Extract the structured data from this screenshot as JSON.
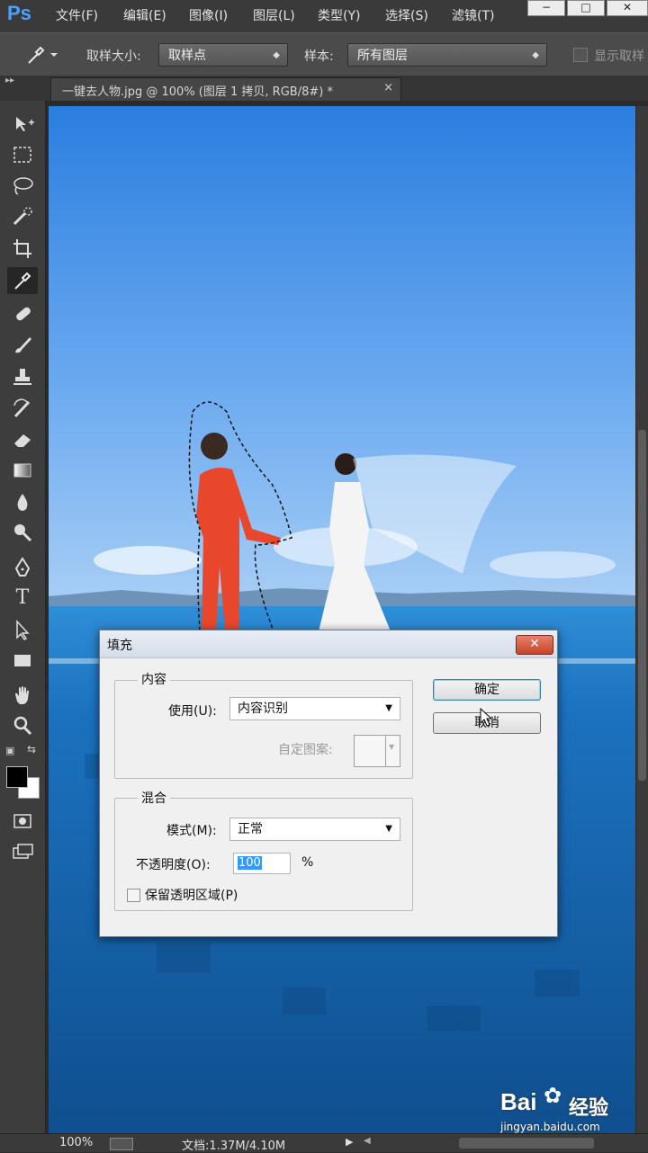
{
  "app": {
    "logo": "Ps",
    "menu": [
      "文件(F)",
      "编辑(E)",
      "图像(I)",
      "图层(L)",
      "类型(Y)",
      "选择(S)",
      "滤镜(T)"
    ],
    "window_buttons": [
      "−",
      "□",
      "✕"
    ]
  },
  "options_bar": {
    "tool_icon": "eyedropper-icon",
    "sample_size_label": "取样大小:",
    "sample_size_value": "取样点",
    "sample_label": "样本:",
    "sample_value": "所有图层",
    "show_ring_label": "显示取样"
  },
  "document_tab": {
    "title": "一键去人物.jpg @ 100% (图层 1 拷贝, RGB/8#) *",
    "close": "×"
  },
  "toolbar": {
    "tools": [
      "move-icon",
      "marquee-icon",
      "lasso-icon",
      "quick-select-icon",
      "crop-icon",
      "eyedropper-icon",
      "healing-brush-icon",
      "brush-icon",
      "clone-stamp-icon",
      "history-brush-icon",
      "eraser-icon",
      "gradient-icon",
      "blur-icon",
      "dodge-icon",
      "pen-icon",
      "type-icon",
      "path-select-icon",
      "rectangle-icon",
      "hand-icon",
      "zoom-icon"
    ],
    "type_glyph": "T",
    "active_tool": "eyedropper-icon",
    "foreground_color": "#000000",
    "background_color": "#ffffff"
  },
  "status_bar": {
    "zoom": "100%",
    "doc_info": "文档:1.37M/4.10M"
  },
  "dialog": {
    "title": "填充",
    "content_group": "内容",
    "use_label": "使用(U):",
    "use_value": "内容识别",
    "custom_pattern_label": "自定图案:",
    "blend_group": "混合",
    "mode_label": "模式(M):",
    "mode_value": "正常",
    "opacity_label": "不透明度(O):",
    "opacity_value": "100",
    "opacity_unit": "%",
    "preserve_label": "保留透明区域(P)",
    "ok_button": "确定",
    "cancel_button": "取消"
  },
  "watermark": {
    "brand": "Bai",
    "brand_suffix": "经验",
    "url": "jingyan.baidu.com"
  },
  "colors": {
    "accent_blue": "#4ea2ff",
    "close_red": "#c5442a"
  }
}
